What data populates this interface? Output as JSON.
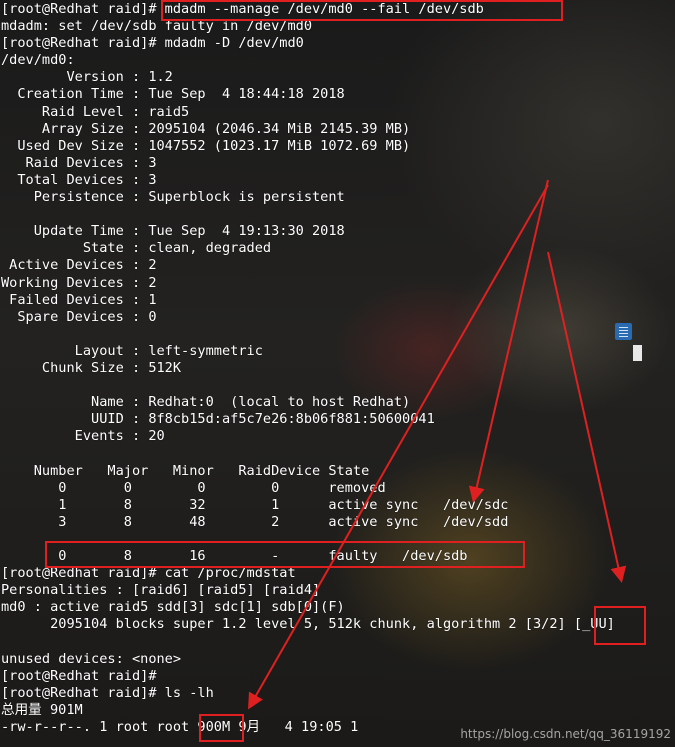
{
  "terminal": {
    "lines": [
      "[root@Redhat raid]# mdadm --manage /dev/md0 --fail /dev/sdb",
      "mdadm: set /dev/sdb faulty in /dev/md0",
      "[root@Redhat raid]# mdadm -D /dev/md0",
      "/dev/md0:",
      "        Version : 1.2",
      "  Creation Time : Tue Sep  4 18:44:18 2018",
      "     Raid Level : raid5",
      "     Array Size : 2095104 (2046.34 MiB 2145.39 MB)",
      "  Used Dev Size : 1047552 (1023.17 MiB 1072.69 MB)",
      "   Raid Devices : 3",
      "  Total Devices : 3",
      "    Persistence : Superblock is persistent",
      "",
      "    Update Time : Tue Sep  4 19:13:30 2018",
      "          State : clean, degraded",
      " Active Devices : 2",
      "Working Devices : 2",
      " Failed Devices : 1",
      "  Spare Devices : 0",
      "",
      "         Layout : left-symmetric",
      "     Chunk Size : 512K",
      "",
      "           Name : Redhat:0  (local to host Redhat)",
      "           UUID : 8f8cb15d:af5c7e26:8b06f881:50600041",
      "         Events : 20",
      "",
      "    Number   Major   Minor   RaidDevice State",
      "       0       0        0        0      removed",
      "       1       8       32        1      active sync   /dev/sdc",
      "       3       8       48        2      active sync   /dev/sdd",
      "",
      "       0       8       16        -      faulty   /dev/sdb",
      "[root@Redhat raid]# cat /proc/mdstat",
      "Personalities : [raid6] [raid5] [raid4]",
      "md0 : active raid5 sdd[3] sdc[1] sdb[0](F)",
      "      2095104 blocks super 1.2 level 5, 512k chunk, algorithm 2 [3/2] [_UU]",
      "",
      "unused devices: <none>",
      "[root@Redhat raid]#",
      "[root@Redhat raid]# ls -lh",
      "总用量 901M",
      "-rw-r--r--. 1 root root 900M 9月   4 19:05 1"
    ]
  },
  "watermark": "https://blog.csdn.net/qq_36119192",
  "colors": {
    "highlight": "#e02020",
    "text": "#ffffff"
  }
}
